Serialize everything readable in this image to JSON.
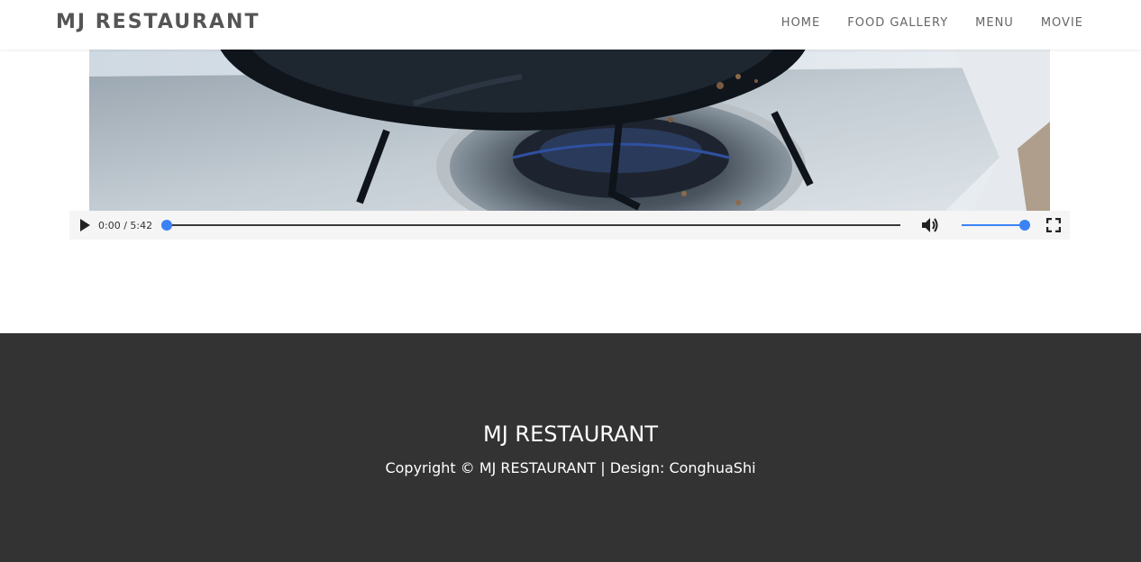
{
  "header": {
    "brand": "MJ RESTAURANT",
    "nav": [
      {
        "label": "HOME"
      },
      {
        "label": "FOOD GALLERY"
      },
      {
        "label": "MENU"
      },
      {
        "label": "MOVIE"
      }
    ]
  },
  "video": {
    "current_time": "0:00",
    "duration": "5:42",
    "time_display": "0:00 / 5:42",
    "progress_fraction": 0.0,
    "volume_fraction": 1.0,
    "icons": {
      "play": "play-icon",
      "volume": "volume-icon",
      "fullscreen": "fullscreen-icon"
    }
  },
  "footer": {
    "title": "MJ RESTAURANT",
    "copyright": "Copyright © MJ RESTAURANT | Design: ConghuaShi"
  },
  "colors": {
    "footer_bg": "#333333",
    "accent": "#3b82f6",
    "brand_text": "#555555"
  }
}
